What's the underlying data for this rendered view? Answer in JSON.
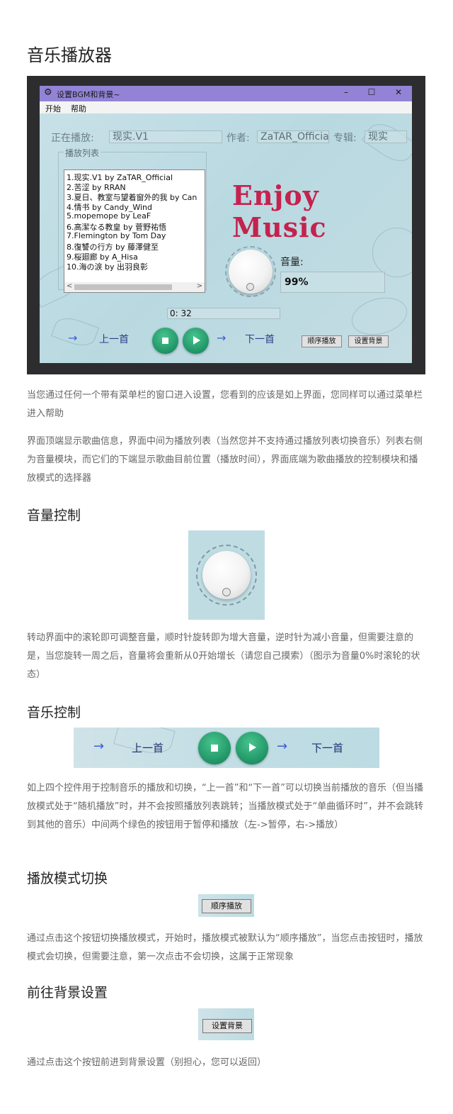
{
  "doc": {
    "title": "音乐播放器",
    "sections": {
      "volume": "音量控制",
      "music": "音乐控制",
      "mode": "播放模式切换",
      "bg": "前往背景设置"
    },
    "paragraphs": {
      "p1": "当您通过任何一个带有菜单栏的窗口进入设置，您看到的应该是如上界面，您同样可以通过菜单栏进入帮助",
      "p2": "界面顶端显示歌曲信息，界面中间为播放列表（当然您并不支持通过播放列表切换音乐）列表右侧为音量模块，而它们的下端显示歌曲目前位置（播放时间），界面底端为歌曲播放的控制模块和播放模式的选择器",
      "p3": "转动界面中的滚轮即可调整音量，顺时针旋转即为增大音量，逆时针为减小音量，但需要注意的是，当您旋转一周之后，音量将会重新从0开始增长（请您自己摸索）（图示为音量0%时滚轮的状态）",
      "p4": "如上四个控件用于控制音乐的播放和切换，“上一首”和“下一首”可以切换当前播放的音乐（但当播放模式处于“随机播放”时，并不会按照播放列表跳转；当播放模式处于“单曲循环时”，并不会跳转到其他的音乐）中间两个绿色的按钮用于暂停和播放（左->暂停，右->播放）",
      "p5": "通过点击这个按钮切换播放模式，开始时，播放模式被默认为“顺序播放”，当您点击按钮时，播放模式会切换，但需要注意，第一次点击不会切换，这属于正常现象",
      "p6": "通过点击这个按钮前进到背景设置（别担心，您可以返回）"
    }
  },
  "app": {
    "window_title": "设置BGM和背景~",
    "window_controls": {
      "minimize": "–",
      "maximize": "☐",
      "close": "✕"
    },
    "menu": {
      "start": "开始",
      "help": "帮助"
    },
    "now_playing_label": "正在播放:",
    "now_playing_value": "现实.V1",
    "author_label": "作者:",
    "author_value": "ZaTAR_Official",
    "album_label": "专辑:",
    "album_value": "现实",
    "playlist_caption": "播放列表",
    "playlist": [
      "1.现实.V1 by ZaTAR_Official",
      "2.苦涩 by RRAN",
      "3.夏日、教室与望着窗外的我 by Can",
      "4.情书 by Candy_Wind",
      "5.mopemope by LeaF",
      "6.高潔なる教皇 by 菅野祐悟",
      "7.Flemington by Tom Day",
      "8.復讐の行方 by 藤澤健至",
      "9.桜廻廊 by A_Hisa",
      "10.海の涙 by 出羽良彰"
    ],
    "scroll_left": "<",
    "scroll_right": ">",
    "enjoy_text": "Enjoy Music",
    "volume_label": "音量:",
    "volume_value": "99%",
    "volume_level": 0.99,
    "time_value": "0: 32",
    "prev_label": "上一首",
    "next_label": "下一首",
    "mode_button": "顺序播放",
    "bg_button": "设置背景",
    "icons": {
      "gear": "⚙",
      "arrow": "→"
    }
  },
  "figures": {
    "ctrl_prev": "上一首",
    "ctrl_next": "下一首",
    "mode_button": "顺序播放",
    "bg_button": "设置背景"
  }
}
